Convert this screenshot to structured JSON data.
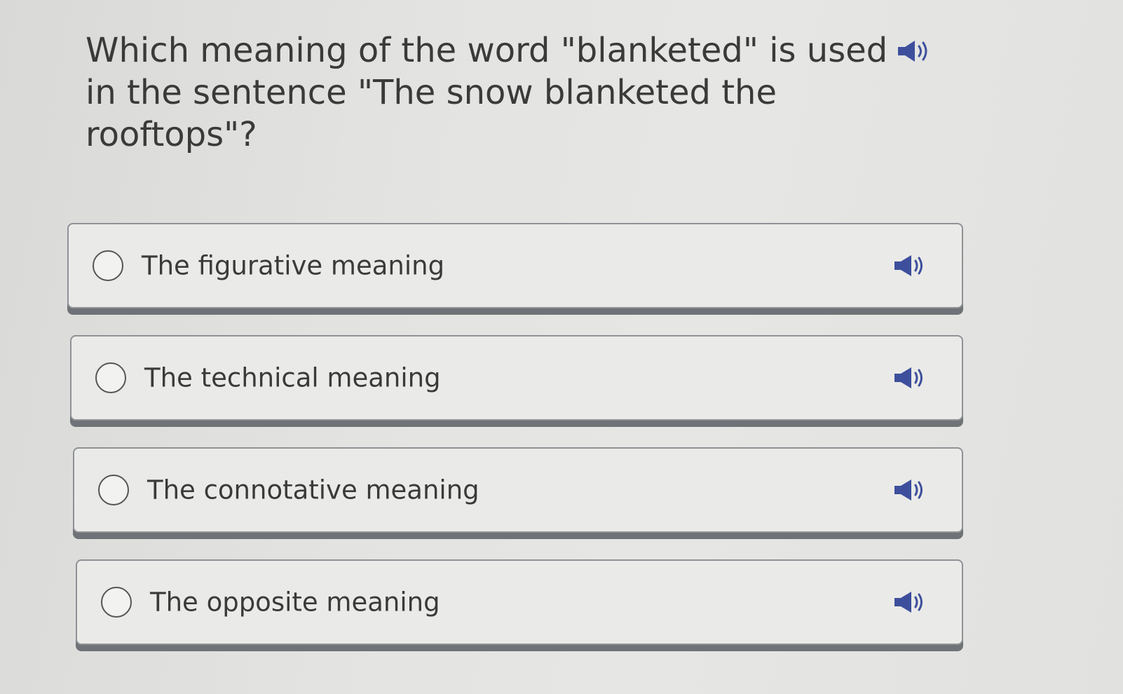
{
  "question": {
    "text": "Which meaning of the word \"blanketed\" is used in the sentence \"The snow blanketed the rooftops\"?",
    "audio_icon": "speaker-icon"
  },
  "options": [
    {
      "label": "The figurative meaning",
      "audio_icon": "speaker-icon"
    },
    {
      "label": "The technical meaning",
      "audio_icon": "speaker-icon"
    },
    {
      "label": "The connotative meaning",
      "audio_icon": "speaker-icon"
    },
    {
      "label": "The opposite meaning",
      "audio_icon": "speaker-icon"
    }
  ],
  "colors": {
    "speaker": "#3d4f9c",
    "option_border": "#8f9296",
    "option_shadow": "#6f7276",
    "text": "#3a3a3a"
  }
}
